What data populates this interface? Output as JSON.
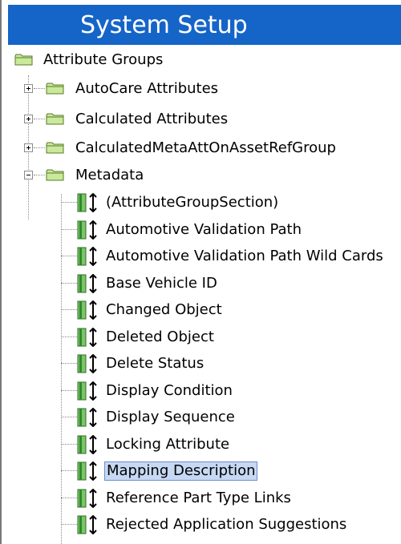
{
  "header": {
    "title": "System Setup"
  },
  "tree": {
    "root": {
      "label": "Attribute Groups"
    },
    "groups": [
      {
        "label": "AutoCare Attributes",
        "expanded": false
      },
      {
        "label": "Calculated Attributes",
        "expanded": false
      },
      {
        "label": "CalculatedMetaAttOnAssetRefGroup",
        "expanded": false
      },
      {
        "label": "Metadata",
        "expanded": true
      }
    ],
    "metadata_items": [
      {
        "label": "(AttributeGroupSection)"
      },
      {
        "label": "Automotive Validation Path"
      },
      {
        "label": "Automotive Validation Path Wild Cards"
      },
      {
        "label": "Base Vehicle ID"
      },
      {
        "label": "Changed Object"
      },
      {
        "label": "Deleted Object"
      },
      {
        "label": "Delete Status"
      },
      {
        "label": "Display Condition"
      },
      {
        "label": "Display Sequence"
      },
      {
        "label": "Locking Attribute"
      },
      {
        "label": "Mapping Description",
        "selected": true
      },
      {
        "label": "Reference Part Type Links"
      },
      {
        "label": "Rejected Application Suggestions"
      }
    ]
  },
  "colors": {
    "header_bg": "#1565c8",
    "folder": "#c9e99b",
    "attr_bar": "#3fa33a",
    "selection": "#c7d8f3"
  }
}
